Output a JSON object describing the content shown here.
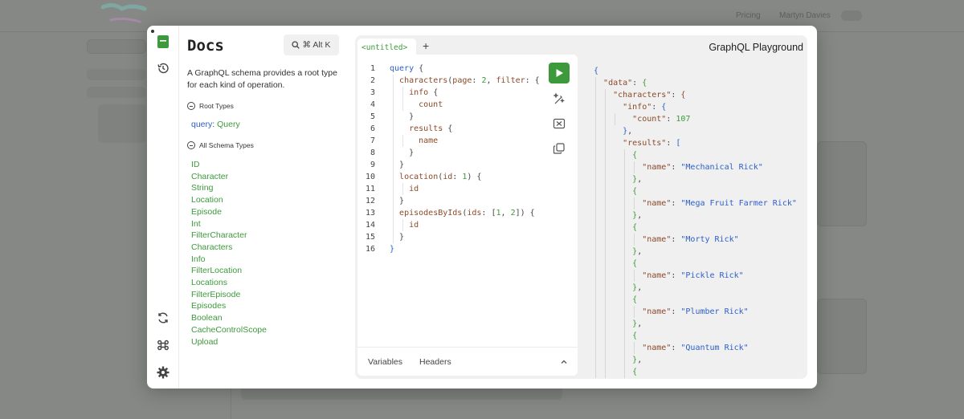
{
  "background": {
    "nav_items": [
      "Pricing",
      "Martyn Davies"
    ]
  },
  "rail": {
    "icons": [
      "docs-icon",
      "history-icon",
      "refetch-icon",
      "shortcuts-icon",
      "settings-icon"
    ]
  },
  "docs": {
    "title": "Docs",
    "search_shortcut": "⌘ Alt K",
    "description": "A GraphQL schema provides a root type for each kind of operation.",
    "root_types_label": "Root Types",
    "root_query_keyword": "query",
    "root_query_type": "Query",
    "all_schema_types_label": "All Schema Types",
    "types": [
      "ID",
      "Character",
      "String",
      "Location",
      "Episode",
      "Int",
      "FilterCharacter",
      "Characters",
      "Info",
      "FilterLocation",
      "Locations",
      "FilterEpisode",
      "Episodes",
      "Boolean",
      "CacheControlScope",
      "Upload"
    ]
  },
  "editor": {
    "tab_label": "<untitled>",
    "add_tab": "+",
    "title": "GraphQL Playground",
    "line_numbers": [
      "1",
      "2",
      "3",
      "4",
      "5",
      "6",
      "7",
      "8",
      "9",
      "10",
      "11",
      "12",
      "13",
      "14",
      "15",
      "16"
    ],
    "variables_label": "Variables",
    "headers_label": "Headers"
  },
  "colors": {
    "accent_green": "#3c9a3c",
    "keyword_blue": "#2e5ec9",
    "field_brown": "#8a4a2a"
  }
}
